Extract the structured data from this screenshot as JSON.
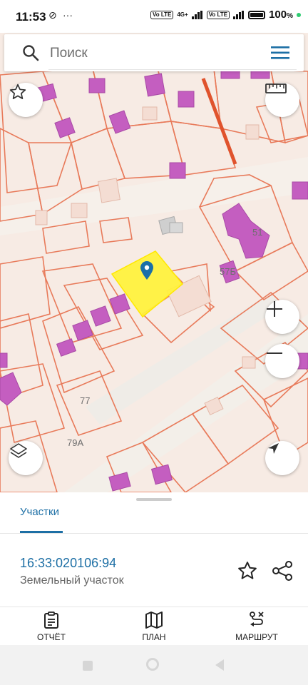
{
  "status_bar": {
    "time": "11:53",
    "network_label": "4G+",
    "volte_1": "Vo LTE",
    "volte_2": "Vo LTE",
    "battery": "100"
  },
  "search": {
    "placeholder": "Поиск"
  },
  "map": {
    "labels": {
      "bld_51": "51",
      "bld_57b": "57Б",
      "bld_77": "77",
      "bld_79a": "79А"
    },
    "colors": {
      "background": "#f7ebe4",
      "parcel_line": "#e87a5a",
      "building": "#c45ec0",
      "road": "#f6f0ea",
      "selected_parcel": "#fff23a"
    }
  },
  "sheet": {
    "tab_label": "Участки",
    "parcel_id": "16:33:020106:94",
    "parcel_type": "Земельный участок"
  },
  "bottom_nav": {
    "report": "ОТЧЁТ",
    "plan": "ПЛАН",
    "route": "МАРШРУТ"
  }
}
